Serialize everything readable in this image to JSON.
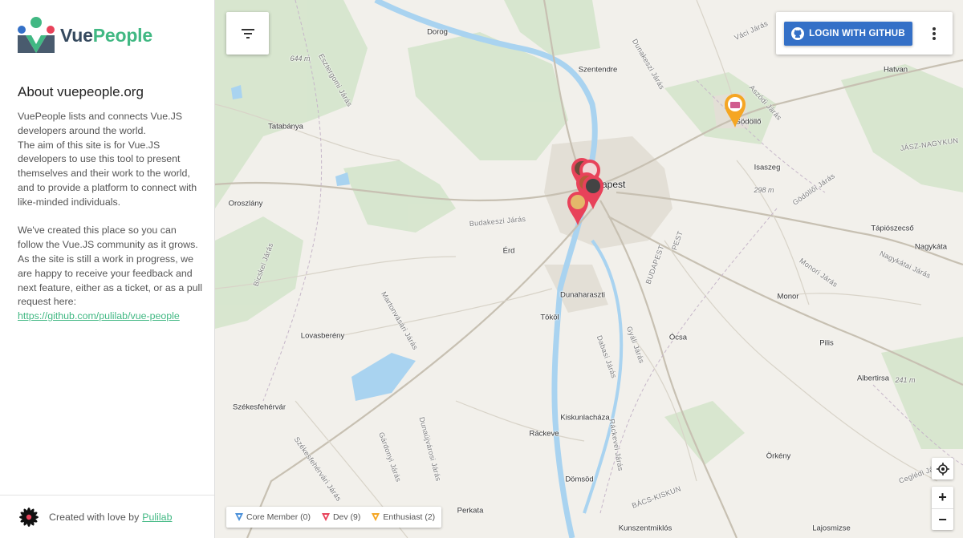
{
  "app": {
    "logo_part1": "Vue",
    "logo_part2": "People"
  },
  "about": {
    "title": "About vuepeople.org",
    "p1_line1": "VuePeople lists and connects Vue.JS developers around the world.",
    "p1_line2": "The aim of this site is for Vue.JS developers to use this tool to present themselves and their work to the world, and to provide a platform to connect with like-minded individuals.",
    "p2": "We've created this place so you can follow the Vue.JS community as it grows. As the site is still a work in progress, we are happy to receive your feedback and next feature, either as a ticket, or as a pull request here:",
    "link": "https://github.com/pulilab/vue-people"
  },
  "footer": {
    "text": "Created with love by",
    "link": "Pulilab"
  },
  "header": {
    "login_label": "LOGIN WITH GITHUB"
  },
  "legend": {
    "items": [
      {
        "label": "Core Member (0)",
        "color": "#4a90d9"
      },
      {
        "label": "Dev (9)",
        "color": "#e8425a"
      },
      {
        "label": "Enthusiast (2)",
        "color": "#f5a623"
      }
    ]
  },
  "map": {
    "places": {
      "dorog": "Dorog",
      "szentendre": "Szentendre",
      "tatabanya": "Tatabánya",
      "budapest": "Budapest",
      "godollo": "Gödöllő",
      "hatvan": "Hatvan",
      "isaszeg": "Isaszeg",
      "oroszlany": "Oroszlány",
      "erd": "Érd",
      "dunaharaszti": "Dunaharaszti",
      "tokol": "Tököl",
      "lovasbereny": "Lovasberény",
      "ocsa": "Ócsa",
      "monor": "Monor",
      "pilis": "Pilis",
      "albertirsa": "Albertirsa",
      "tapioszecso": "Tápiószecső",
      "nagykata": "Nagykáta",
      "szekesfehervar": "Székesfehérvár",
      "kiskunlachaza": "Kiskunlacháza",
      "rackeve": "Ráckeve",
      "domsod": "Dömsöd",
      "orkeny": "Örkény",
      "perkata": "Perkata",
      "kunszentmiklos": "Kunszentmiklós",
      "lajosmizse": "Lajosmizse",
      "alt644": "644 m",
      "alt298": "298 m",
      "alt241": "241 m",
      "r_esztergomi": "Esztergomi Járás",
      "r_dunakeszi": "Dunakeszi Járás",
      "r_vaci": "Váci Járás",
      "r_aszodi": "Aszódi Járás",
      "r_godolloi": "Gödöllői Járás",
      "r_monori": "Monori Járás",
      "r_budakeszi": "Budakeszi Járás",
      "r_gyali": "Gyáli Járás",
      "r_dabasi": "Dabasi Járás",
      "r_martonvasari": "Martonvásári Járás",
      "r_gardonyi": "Gárdonyi Járás",
      "r_ceglédi": "Ceglédi Járás",
      "r_nagykatai": "Nagykátai Járás",
      "r_jasz": "JÁSZ-NAGYKUN",
      "r_budapest": "BUDAPEST",
      "r_pest": "PEST",
      "r_bacs": "BÁCS-KISKUN",
      "r_rackevei": "Ráckevei Járás",
      "r_szekesfehervari": "Székesfehérvári Járás",
      "r_bicskei": "Bicskei Járás",
      "r_dunaujvarosi": "Dunaújvárosi Járás"
    }
  }
}
